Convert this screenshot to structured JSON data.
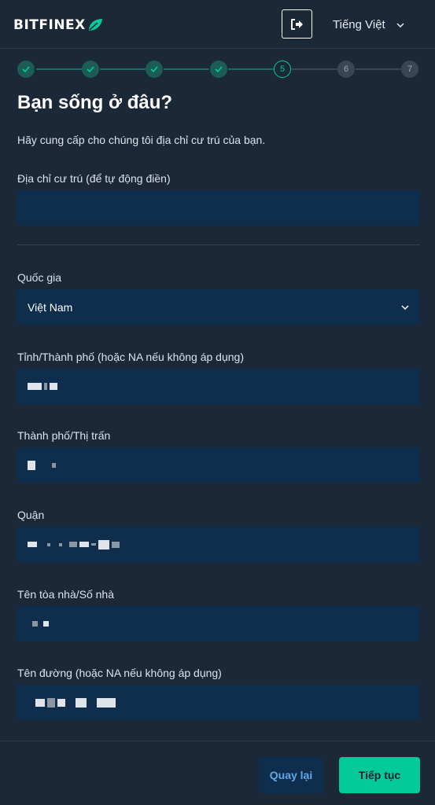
{
  "header": {
    "logo_text": "BITFINEX",
    "logout_icon": "logout-icon",
    "language": "Tiếng Việt"
  },
  "stepper": {
    "steps": [
      {
        "label": "",
        "state": "done"
      },
      {
        "label": "",
        "state": "done"
      },
      {
        "label": "",
        "state": "done"
      },
      {
        "label": "",
        "state": "done"
      },
      {
        "label": "5",
        "state": "current"
      },
      {
        "label": "6",
        "state": "todo"
      },
      {
        "label": "7",
        "state": "todo"
      }
    ]
  },
  "form": {
    "title": "Bạn sống ở đâu?",
    "subtitle": "Hãy cung cấp cho chúng tôi địa chỉ cư trú của bạn.",
    "address_autofill_label": "Địa chỉ cư trú (để tự động điền)",
    "address_autofill_value": "",
    "country_label": "Quốc gia",
    "country_value": "Việt Nam",
    "province_label": "Tỉnh/Thành phố (hoặc NA nếu không áp dụng)",
    "city_label": "Thành phố/Thị trấn",
    "district_label": "Quận",
    "building_label": "Tên tòa nhà/Số nhà",
    "street_label": "Tên đường (hoặc NA nếu không áp dụng)"
  },
  "footer": {
    "back_label": "Quay lại",
    "next_label": "Tiếp tục"
  },
  "colors": {
    "background": "#1b2838",
    "field": "#0f2e4d",
    "accent": "#03ca9b",
    "back_text": "#61a8e8"
  }
}
